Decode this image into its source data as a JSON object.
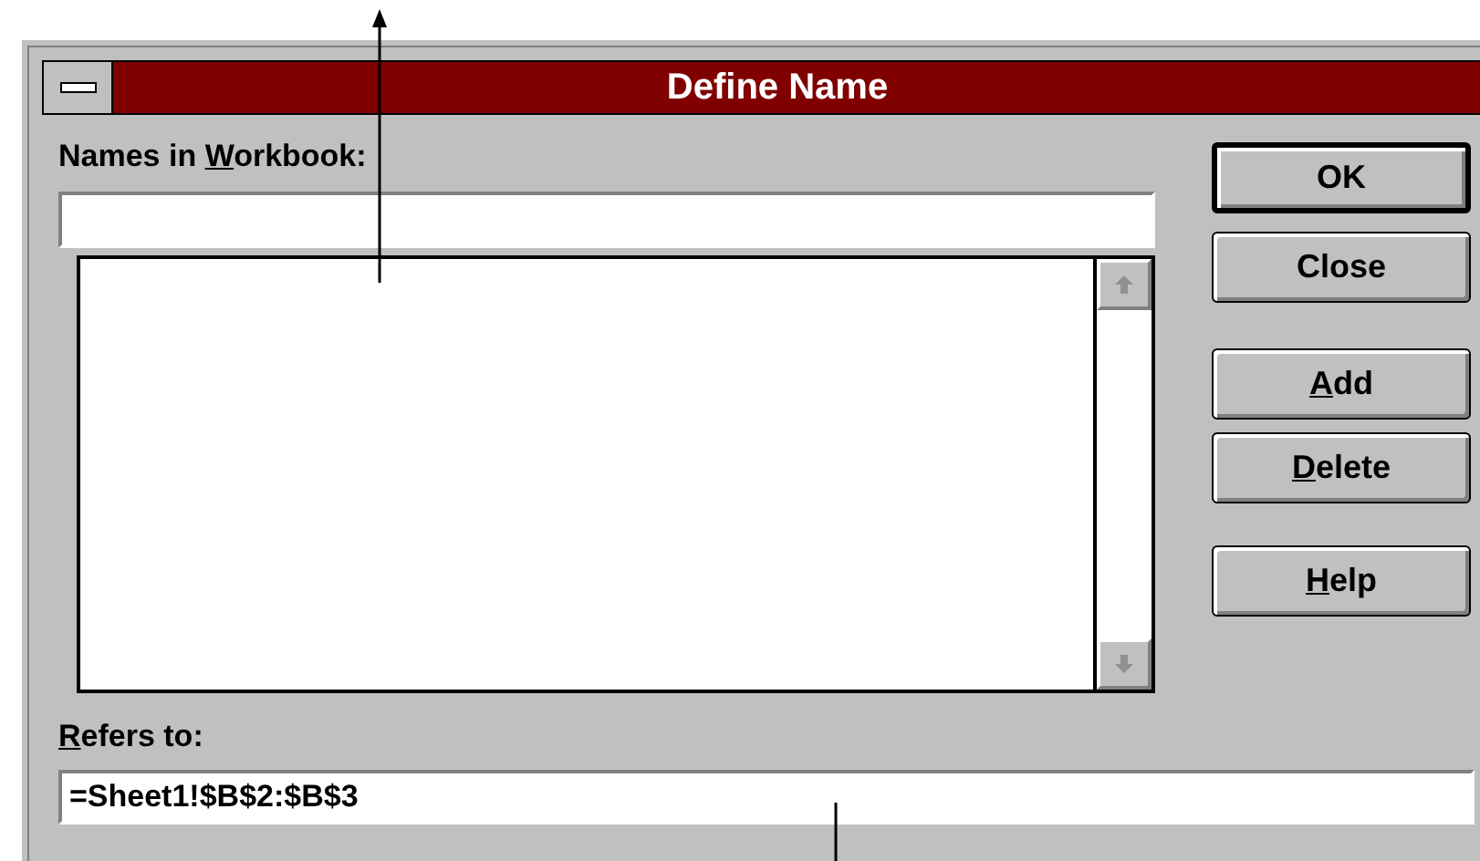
{
  "window": {
    "title": "Define Name"
  },
  "names_label": {
    "pre": "Names in ",
    "key": "W",
    "post": "orkbook:"
  },
  "refers_label": {
    "key": "R",
    "post": "efers to:"
  },
  "refers_field": {
    "value": "=Sheet1!$B$2:$B$3"
  },
  "buttons": [
    {
      "label": {
        "pre": "OK"
      },
      "default": true
    },
    {
      "label": {
        "pre": "Close"
      },
      "default": false
    },
    {
      "label": {
        "key": "A",
        "post": "dd"
      },
      "default": false
    },
    {
      "label": {
        "key": "D",
        "post": "elete"
      },
      "default": false
    },
    {
      "label": {
        "key": "H",
        "post": "elp"
      },
      "default": false
    }
  ]
}
